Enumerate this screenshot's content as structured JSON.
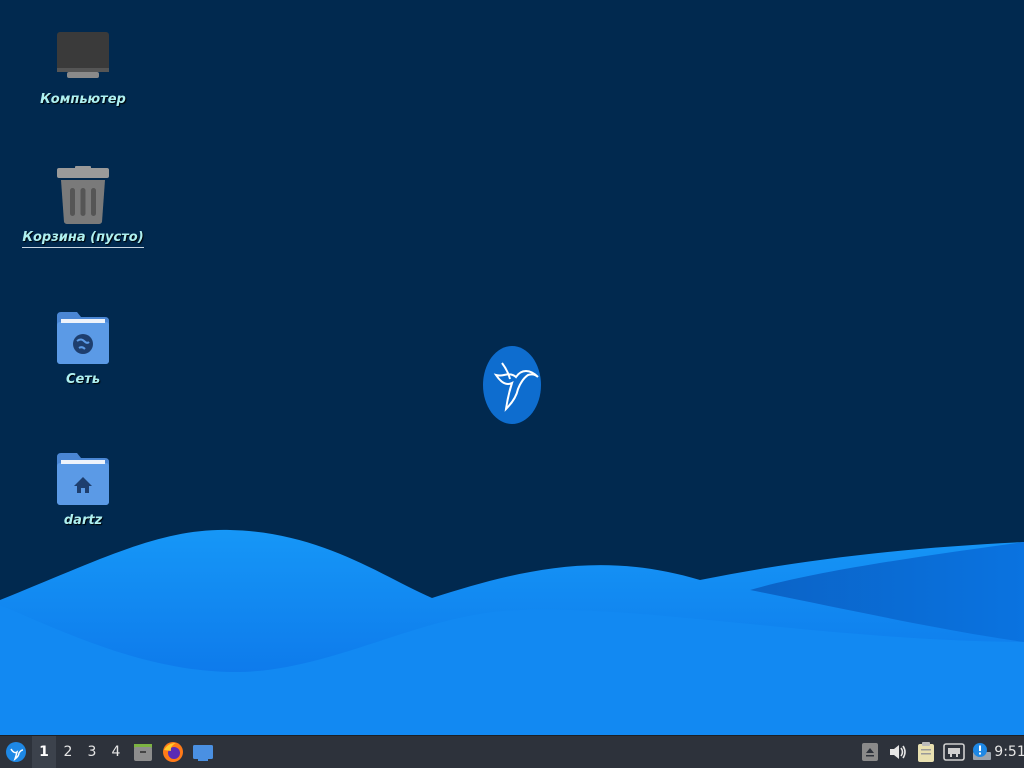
{
  "desktop": {
    "icons": [
      {
        "label": "Компьютер",
        "icon": "computer-icon"
      },
      {
        "label": "Корзина (пусто)",
        "icon": "trash-icon"
      },
      {
        "label": "Сеть",
        "icon": "network-folder-icon"
      },
      {
        "label": "dartz",
        "icon": "home-folder-icon"
      }
    ],
    "center_logo": "hummingbird-logo-icon"
  },
  "taskbar": {
    "start_icon": "start-menu-icon",
    "workspaces": [
      "1",
      "2",
      "3",
      "4"
    ],
    "active_workspace": "1",
    "launchers": [
      {
        "name": "file-manager-icon"
      },
      {
        "name": "firefox-icon"
      },
      {
        "name": "show-desktop-icon"
      }
    ],
    "tray": [
      "eject-icon",
      "volume-icon",
      "clipboard-icon",
      "network-icon",
      "updates-icon"
    ],
    "clock": "9:51"
  },
  "colors": {
    "background": "#01294f",
    "wave_light": "#1493f5",
    "wave_dark": "#0b6fd8",
    "taskbar": "#2d323b",
    "icon_label": "#aef0f0"
  }
}
